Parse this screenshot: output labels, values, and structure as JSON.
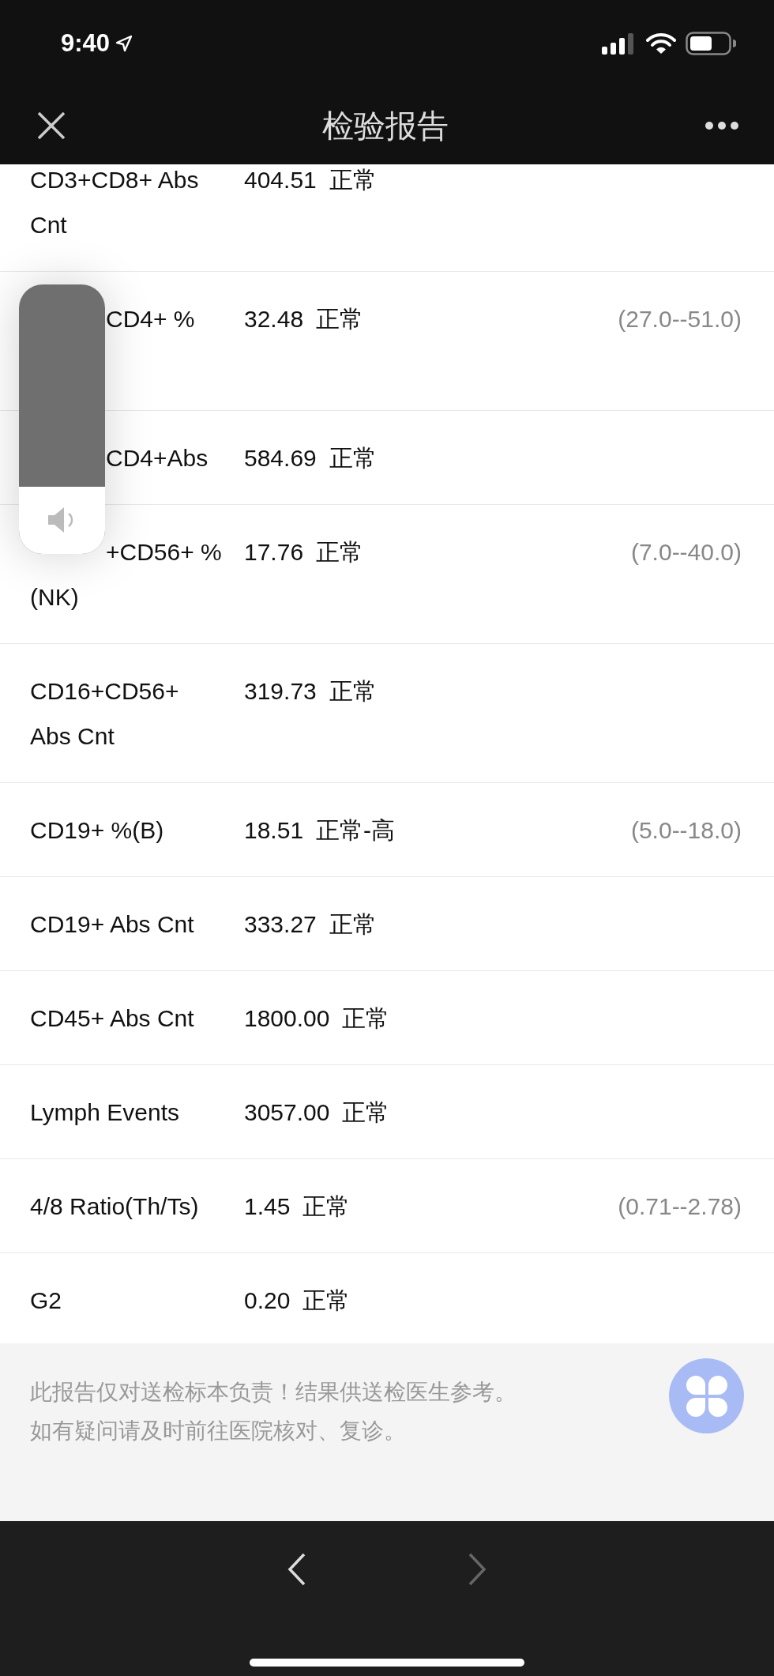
{
  "status_bar": {
    "time": "9:40"
  },
  "header": {
    "title": "检验报告"
  },
  "rows": [
    {
      "kind": "plain",
      "label": "CD3+CD8+ Abs\nCnt",
      "value": "404.51",
      "status": "正常"
    },
    {
      "kind": "covered_tall",
      "label": "CD4+ %",
      "value": "32.48",
      "status": "正常",
      "range": "(27.0--51.0)"
    },
    {
      "kind": "covered",
      "label": "CD4+Abs",
      "value": "584.69",
      "status": "正常"
    },
    {
      "kind": "covered",
      "label": "+CD56+ %\n(NK)",
      "value": "17.76",
      "status": "正常",
      "range": "(7.0--40.0)"
    },
    {
      "kind": "plain",
      "label": "CD16+CD56+\nAbs Cnt",
      "value": "319.73",
      "status": "正常"
    },
    {
      "kind": "plain",
      "label": "CD19+ %(B)",
      "value": "18.51",
      "status": "正常-高",
      "range": "(5.0--18.0)"
    },
    {
      "kind": "plain",
      "label": "CD19+ Abs Cnt",
      "value": "333.27",
      "status": "正常"
    },
    {
      "kind": "plain",
      "label": "CD45+ Abs Cnt",
      "value": "1800.00",
      "status": "正常"
    },
    {
      "kind": "plain",
      "label": "Lymph Events",
      "value": "3057.00",
      "status": "正常"
    },
    {
      "kind": "plain",
      "label": "4/8 Ratio(Th/Ts)",
      "value": "1.45",
      "status": "正常",
      "range": "(0.71--2.78)"
    },
    {
      "kind": "plain",
      "label": "G2",
      "value": "0.20",
      "status": "正常"
    }
  ],
  "volume": {
    "level": 0.25
  },
  "footer": {
    "lines": [
      "此报告仅对送检标本负责！结果供送检医生参考。",
      "如有疑问请及时前往医院核对、复诊。"
    ]
  },
  "toolbar": {
    "back_disabled": false,
    "forward_disabled": true
  }
}
